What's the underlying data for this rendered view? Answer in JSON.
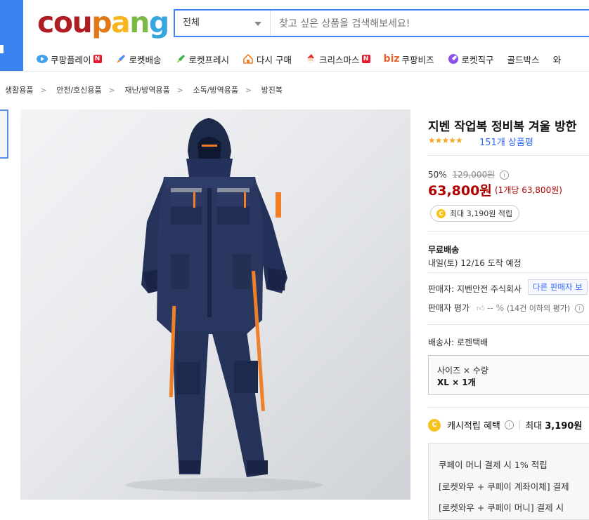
{
  "header": {
    "logo": "coupang",
    "logo_colors": [
      "#ae1c24",
      "#e27919",
      "#f7b51f",
      "#7ab943",
      "#37a6e0"
    ],
    "search_category": "전체",
    "search_placeholder": "찾고 싶은 상품을 검색해보세요!"
  },
  "nav": {
    "items": [
      {
        "label": "쿠팡플레이",
        "badge": "N",
        "icon": "coupang-play-icon"
      },
      {
        "label": "로켓배송",
        "icon": "rocket-icon"
      },
      {
        "label": "로켓프레시",
        "icon": "rocket-fresh-icon"
      },
      {
        "label": "다시 구매",
        "icon": "rebuy-icon"
      },
      {
        "label": "크리스마스",
        "badge": "N",
        "icon": "santa-icon"
      },
      {
        "label": "쿠팡비즈",
        "prefix": "biz",
        "icon": "biz-icon"
      },
      {
        "label": "로켓직구",
        "icon": "rocket-global-icon"
      },
      {
        "label": "골드박스"
      },
      {
        "label": "와"
      }
    ]
  },
  "breadcrumb": [
    "생활용품",
    "안전/호신용품",
    "재난/방역용품",
    "소독/방역용품",
    "방진복"
  ],
  "product": {
    "title": "지벤 작업복 정비복 겨울 방한",
    "stars": "★★★★★",
    "rating": 4.5,
    "review_count": "151개 상품평",
    "discount_rate": "50%",
    "original_price": "129,000원",
    "price": "63,800원",
    "unit_price": "(1개당 63,800원)",
    "cash_reward": "최대 3,190원 적립"
  },
  "shipping": {
    "label": "무료배송",
    "arrival": "내일(토) 12/16 도착 예정"
  },
  "seller": {
    "label": "판매자:",
    "name": "지벤안전 주식회사",
    "other_sellers": "다른 판매자 보",
    "rating_label": "판매자 평가",
    "rating_value": "-- %",
    "rating_note": "(14건 이하의 평가)",
    "carrier_label": "배송사:",
    "carrier": "로젠택배"
  },
  "option": {
    "header": "사이즈 × 수량",
    "value": "XL × 1개"
  },
  "cash": {
    "label": "캐시적립 혜택",
    "divider": "|",
    "value_prefix": "최대",
    "value": "3,190원"
  },
  "benefits": [
    "쿠페이 머니 결제 시 1% 적립",
    "[로켓와우 + 쿠페이 계좌이체] 결제",
    "[로켓와우 + 쿠페이 머니] 결제 시"
  ]
}
